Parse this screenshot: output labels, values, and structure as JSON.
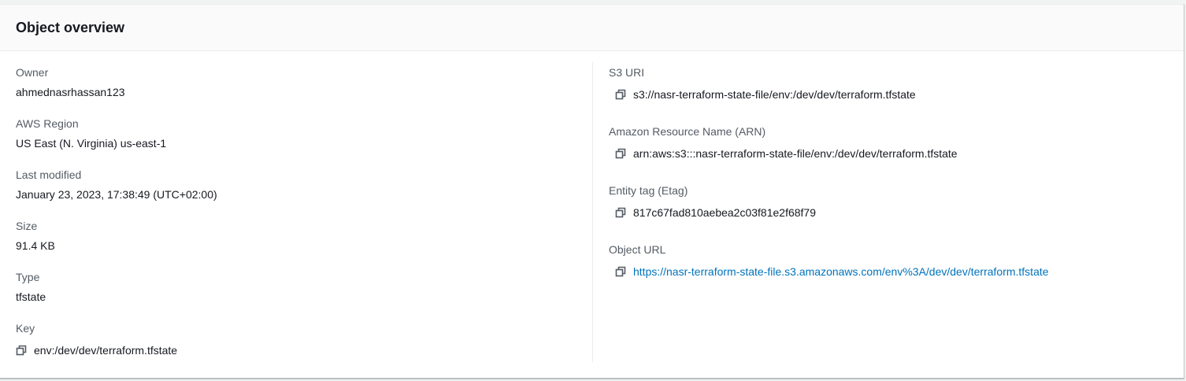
{
  "panel": {
    "title": "Object overview"
  },
  "left": {
    "owner": {
      "label": "Owner",
      "value": "ahmednasrhassan123"
    },
    "region": {
      "label": "AWS Region",
      "value": "US East (N. Virginia) us-east-1"
    },
    "last_modified": {
      "label": "Last modified",
      "value": "January 23, 2023, 17:38:49 (UTC+02:00)"
    },
    "size": {
      "label": "Size",
      "value": "91.4 KB"
    },
    "type": {
      "label": "Type",
      "value": "tfstate"
    },
    "key": {
      "label": "Key",
      "value": "env:/dev/dev/terraform.tfstate",
      "icon": "copy-icon"
    }
  },
  "right": {
    "s3_uri": {
      "label": "S3 URI",
      "value": "s3://nasr-terraform-state-file/env:/dev/dev/terraform.tfstate",
      "icon": "copy-icon"
    },
    "arn": {
      "label": "Amazon Resource Name (ARN)",
      "value": "arn:aws:s3:::nasr-terraform-state-file/env:/dev/dev/terraform.tfstate",
      "icon": "copy-icon"
    },
    "etag": {
      "label": "Entity tag (Etag)",
      "value": "817c67fad810aebea2c03f81e2f68f79",
      "icon": "copy-icon"
    },
    "object_url": {
      "label": "Object URL",
      "value": "https://nasr-terraform-state-file.s3.amazonaws.com/env%3A/dev/dev/terraform.tfstate",
      "icon": "copy-icon"
    }
  },
  "colors": {
    "link": "#0073bb",
    "label": "#545b64",
    "text": "#16191f",
    "header_bg": "#fafafa"
  }
}
